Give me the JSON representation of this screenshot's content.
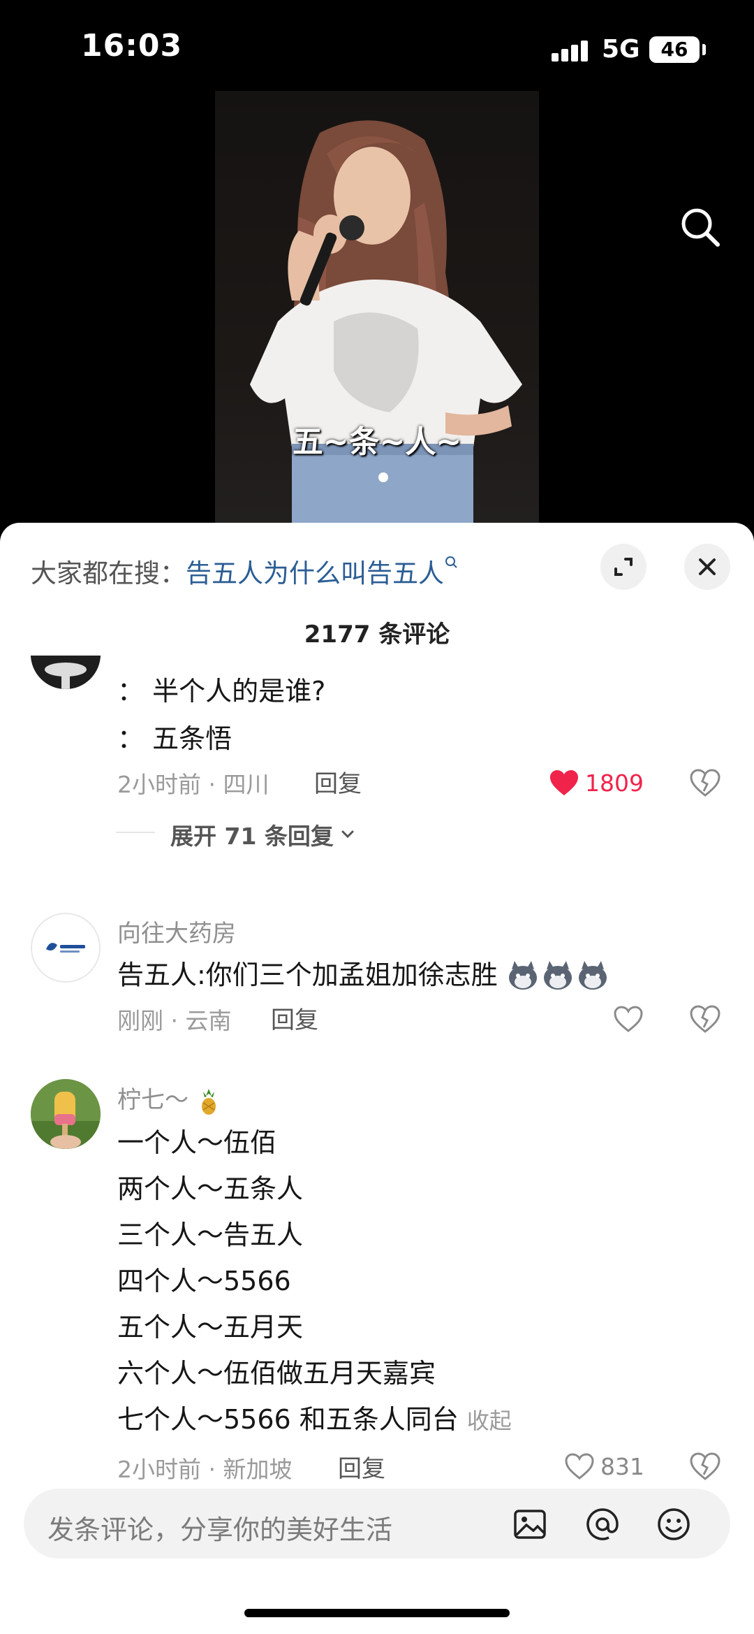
{
  "status_bar": {
    "time": "16:03",
    "network": "5G",
    "battery": "46"
  },
  "video": {
    "caption": "五~条~人~"
  },
  "hot_search": {
    "prefix": "大家都在搜：",
    "query": "告五人为什么叫告五人"
  },
  "comment_count": "2177 条评论",
  "comments": [
    {
      "lines": [
        "：  半个人的是谁?",
        "：  五条悟"
      ],
      "meta": "2小时前 · 四川",
      "reply": "回复",
      "likes": "1809",
      "expand": "展开 71 条回复"
    },
    {
      "username": "向往大药房",
      "text": "告五人:你们三个加孟姐加徐志胜",
      "meta": "刚刚 · 云南",
      "reply": "回复"
    },
    {
      "username": "柠七～",
      "lines": [
        "一个人～伍佰",
        "两个人～五条人",
        "三个人～告五人",
        "四个人～5566",
        "五个人～五月天",
        "六个人～伍佰做五月天嘉宾",
        "七个人～5566 和五条人同台"
      ],
      "collapse": "收起",
      "meta": "2小时前 · 新加坡",
      "reply": "回复",
      "likes": "831"
    }
  ],
  "input": {
    "placeholder": "发条评论，分享你的美好生活"
  }
}
